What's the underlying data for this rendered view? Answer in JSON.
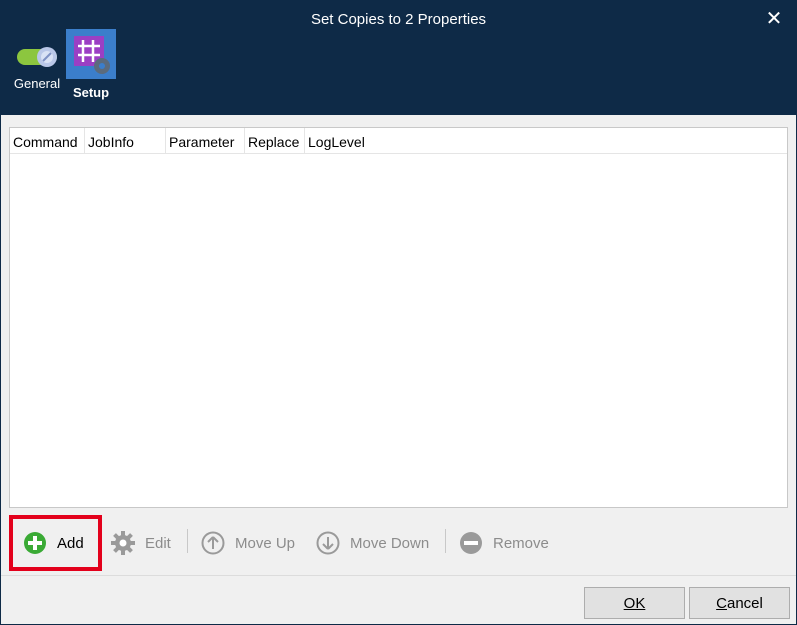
{
  "window": {
    "title": "Set Copies to 2 Properties"
  },
  "nav": {
    "tabs": [
      {
        "label": "General",
        "icon": "toggle-icon"
      },
      {
        "label": "Setup",
        "icon": "hash-gear-icon"
      }
    ]
  },
  "table": {
    "columns": [
      "Command",
      "JobInfo",
      "Parameter",
      "Replace",
      "LogLevel"
    ],
    "rows": []
  },
  "toolbar": {
    "add_label": "Add",
    "edit_label": "Edit",
    "move_up_label": "Move Up",
    "move_down_label": "Move Down",
    "remove_label": "Remove"
  },
  "footer": {
    "ok_label": "OK",
    "cancel_label": "Cancel"
  },
  "colors": {
    "header_bg": "#0e2a47",
    "add_green": "#3aaa35",
    "highlight_red": "#e3001b",
    "setup_tile": "#9b3fc4"
  }
}
